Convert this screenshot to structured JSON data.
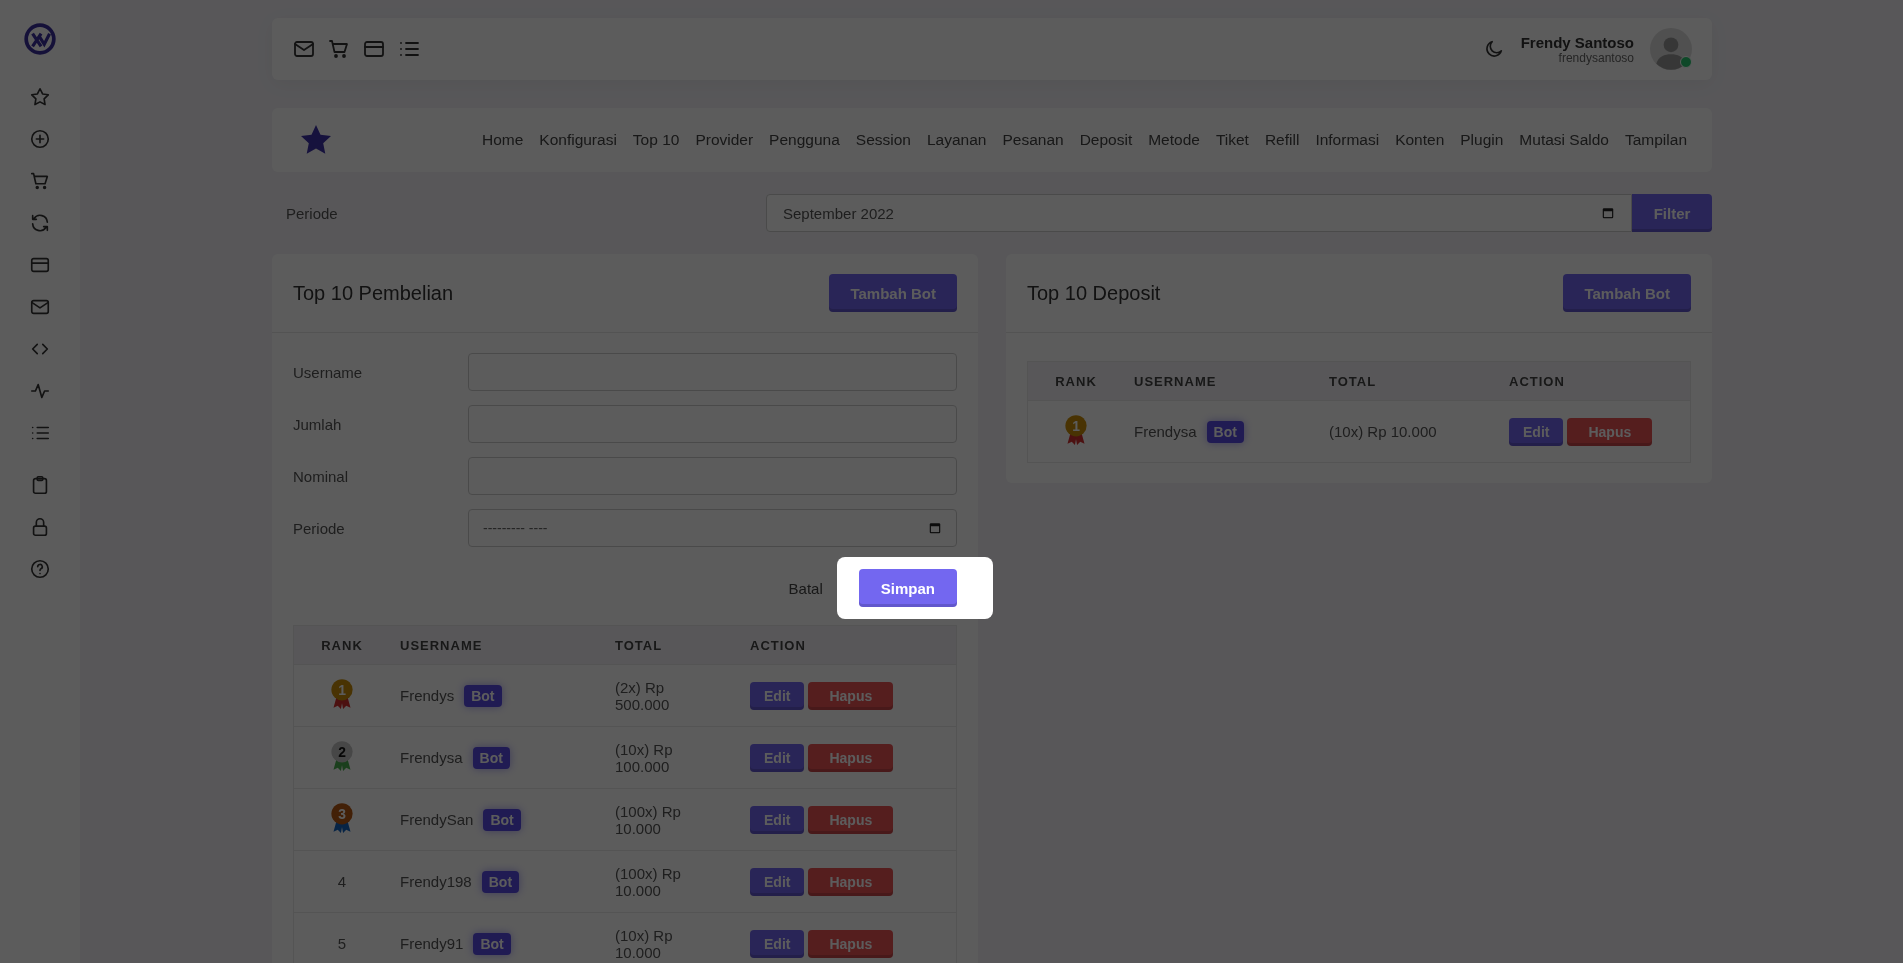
{
  "topbar": {
    "user": {
      "name": "Frendy Santoso",
      "username": "frendysantoso",
      "online": true
    }
  },
  "nav": {
    "items": [
      "Home",
      "Konfigurasi",
      "Top 10",
      "Provider",
      "Pengguna",
      "Session",
      "Layanan",
      "Pesanan",
      "Deposit",
      "Metode",
      "Tiket",
      "Refill",
      "Informasi",
      "Konten",
      "Plugin",
      "Mutasi Saldo",
      "Tampilan"
    ]
  },
  "filter": {
    "label": "Periode",
    "value": "September 2022",
    "button": "Filter"
  },
  "purchases": {
    "title": "Top 10 Pembelian",
    "add_button": "Tambah Bot",
    "form": {
      "fields": [
        {
          "label": "Username",
          "kind": "text"
        },
        {
          "label": "Jumlah",
          "kind": "text"
        },
        {
          "label": "Nominal",
          "kind": "text"
        },
        {
          "label": "Periode",
          "kind": "month",
          "placeholder": "--------- ----"
        }
      ],
      "cancel": "Batal",
      "save": "Simpan",
      "spotlight": true
    },
    "table": {
      "columns": [
        "RANK",
        "USERNAME",
        "TOTAL",
        "ACTION"
      ],
      "rows": [
        {
          "kind": "gold",
          "rank": "1",
          "username": "Frendys",
          "tag": "Bot",
          "total": "(2x) Rp 500.000",
          "actions": [
            "Edit",
            "Hapus"
          ]
        },
        {
          "kind": "silver",
          "rank": "2",
          "username": "Frendysa",
          "tag": "Bot",
          "total": "(10x) Rp 100.000",
          "actions": [
            "Edit",
            "Hapus"
          ]
        },
        {
          "kind": "bronze",
          "rank": "3",
          "username": "FrendySan",
          "tag": "Bot",
          "total": "(100x) Rp 10.000",
          "actions": [
            "Edit",
            "Hapus"
          ]
        },
        {
          "kind": "number",
          "rank": "4",
          "username": "Frendy198",
          "tag": "Bot",
          "total": "(100x) Rp 10.000",
          "actions": [
            "Edit",
            "Hapus"
          ]
        },
        {
          "kind": "number",
          "rank": "5",
          "username": "Frendy91",
          "tag": "Bot",
          "total": "(10x) Rp 10.000",
          "actions": [
            "Edit",
            "Hapus"
          ]
        }
      ]
    }
  },
  "deposits": {
    "title": "Top 10 Deposit",
    "add_button": "Tambah Bot",
    "table": {
      "columns": [
        "RANK",
        "USERNAME",
        "TOTAL",
        "ACTION"
      ],
      "rows": [
        {
          "kind": "gold",
          "rank": "1",
          "username": "Frendysa",
          "tag": "Bot",
          "total": "(10x) Rp 10.000",
          "actions": [
            "Edit",
            "Hapus"
          ]
        }
      ]
    }
  }
}
